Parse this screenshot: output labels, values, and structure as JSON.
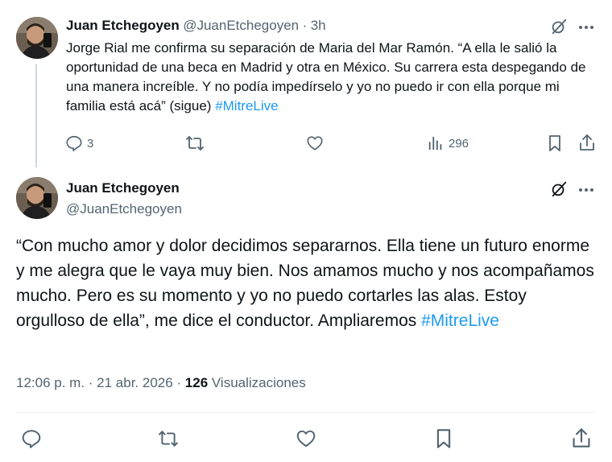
{
  "tweet1": {
    "display_name": "Juan Etchegoyen",
    "handle": "@JuanEtchegoyen",
    "separator": "·",
    "time": "3h",
    "text_before": "Jorge Rial me confirma su separación de Maria del Mar Ramón. “A ella le salió la oportunidad de una beca en Madrid y otra en México. Su carrera esta despegando de una manera increíble. Y no podía impedírselo y yo no puedo ir con ella porque mi familia está acá” (sigue) ",
    "hashtag": "#MitreLive",
    "replies": "3",
    "views": "296"
  },
  "tweet2": {
    "display_name": "Juan Etchegoyen",
    "handle": "@JuanEtchegoyen",
    "text_before": "“Con mucho amor y dolor decidimos separarnos. Ella tiene un futuro enorme y me alegra que le vaya muy bien. Nos amamos mucho y nos acompañamos mucho. Pero es su momento y yo no puedo cortarles las alas. Estoy orgulloso de ella”, me dice el conductor. Ampliaremos ",
    "hashtag": "#MitreLive",
    "timestamp": "12:06 p. m. · 21 abr. 2026 · ",
    "views_count": "126",
    "views_label": " Visualizaciones"
  },
  "icons": {
    "grok": "grok-icon",
    "more": "more-icon",
    "reply": "reply-icon",
    "retweet": "retweet-icon",
    "like": "like-icon",
    "views": "views-icon",
    "bookmark": "bookmark-icon",
    "share": "share-icon"
  },
  "colors": {
    "text": "#0f1419",
    "muted": "#536471",
    "link": "#1d9bf0",
    "divider": "#eff3f4"
  }
}
